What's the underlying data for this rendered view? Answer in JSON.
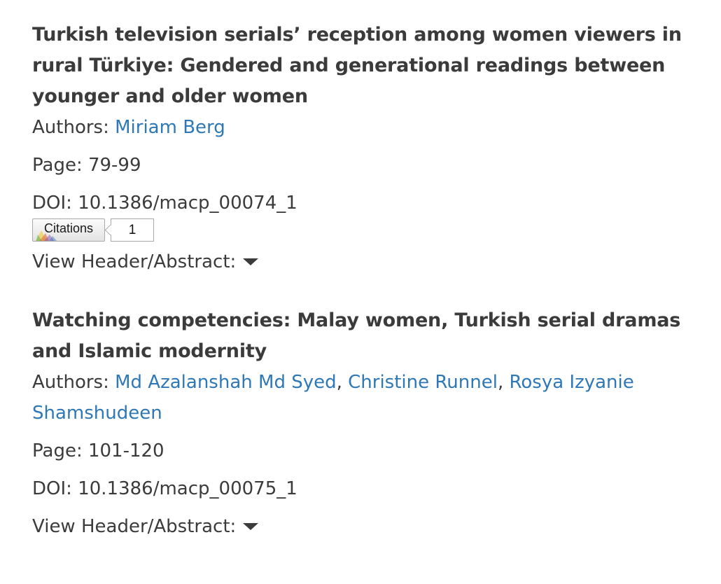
{
  "articles": [
    {
      "title": "Turkish television serials’ reception among women viewers in rural Türkiye: Gendered and generational readings between younger and older women",
      "authors_label": "Authors:",
      "authors": [
        "Miriam Berg"
      ],
      "page_label": "Page:",
      "pages": "79-99",
      "doi_label": "DOI:",
      "doi": "10.1386/macp_00074_1",
      "citations": {
        "label": "Citations",
        "count": "1"
      },
      "view_label": "View Header/Abstract:"
    },
    {
      "title": "Watching competencies: Malay women, Turkish serial dramas and Islamic modernity",
      "authors_label": "Authors:",
      "authors": [
        "Md Azalanshah Md Syed",
        "Christine Runnel",
        "Rosya Izyanie Shamshudeen"
      ],
      "page_label": "Page:",
      "pages": "101-120",
      "doi_label": "DOI:",
      "doi": "10.1386/macp_00075_1",
      "view_label": "View Header/Abstract:"
    }
  ],
  "colors": {
    "link": "#2f78b7",
    "text": "#3b3b3b"
  },
  "icons": {
    "expand": "caret-down-icon",
    "citations_logo": "dimensions-logo-icon"
  }
}
